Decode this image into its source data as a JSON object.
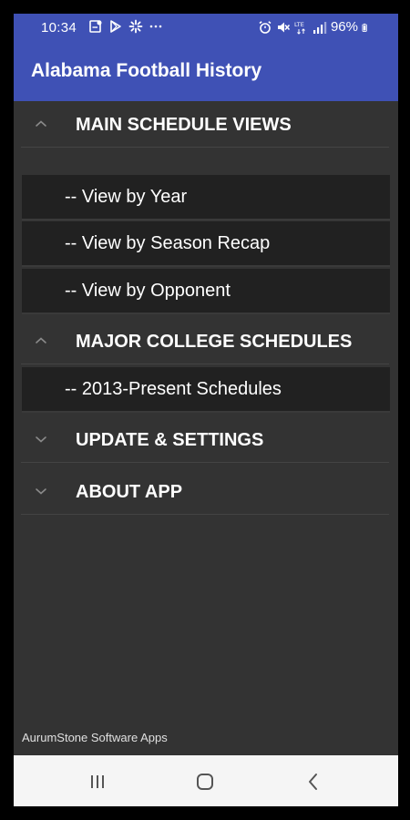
{
  "status_bar": {
    "time": "10:34",
    "battery": "96%",
    "left_icons": [
      "notification-icon",
      "play-store-icon",
      "pinwheel-icon",
      "more-dots-icon"
    ],
    "right_icons": [
      "alarm-icon",
      "mute-icon",
      "lte-icon",
      "signal-icon",
      "battery-icon"
    ]
  },
  "app_bar": {
    "title": "Alabama Football History",
    "background": "#3f51b5"
  },
  "menu": {
    "groups": [
      {
        "label": "MAIN SCHEDULE VIEWS",
        "expanded": true,
        "items": [
          "-- View by Year",
          "-- View by Season Recap",
          "-- View by Opponent"
        ]
      },
      {
        "label": "MAJOR COLLEGE SCHEDULES",
        "expanded": true,
        "items": [
          "-- 2013-Present Schedules"
        ]
      },
      {
        "label": "UPDATE & SETTINGS",
        "expanded": false,
        "items": []
      },
      {
        "label": "ABOUT APP",
        "expanded": false,
        "items": []
      }
    ]
  },
  "footer": {
    "text": "AurumStone Software Apps"
  },
  "nav_bar": {
    "icons": [
      "recents-icon",
      "home-icon",
      "back-icon"
    ]
  }
}
